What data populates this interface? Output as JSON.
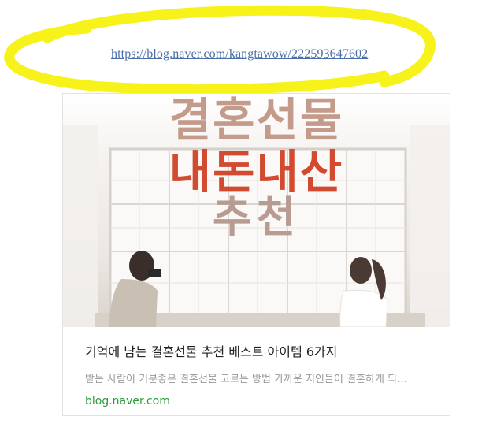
{
  "link": {
    "url_text": "https://blog.naver.com/kangtawow/222593647602"
  },
  "colors": {
    "highlight": "#f7f21a",
    "link": "#4a6ea8",
    "domain": "#2a9d3a"
  },
  "card": {
    "image_title_line1": "결혼선물",
    "image_title_line2": "내돈내산",
    "image_title_line3": "추천",
    "title": "기억에 남는 결혼선물 추천 베스트 아이템 6가지",
    "description": "받는 사람이 기분좋은 결혼선물 고르는 방법 가까운 지인들이 결혼하게 되…",
    "domain": "blog.naver.com"
  }
}
